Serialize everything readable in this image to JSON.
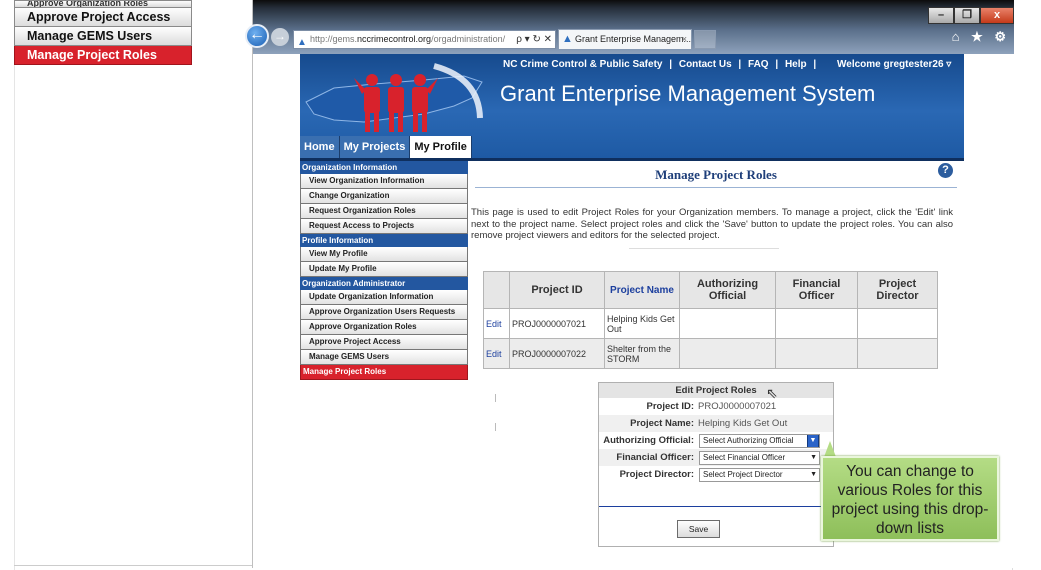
{
  "outer_menu": {
    "items": [
      {
        "label": "Approve Organization Roles"
      },
      {
        "label": "Approve Project Access"
      },
      {
        "label": "Manage GEMS Users"
      },
      {
        "label": "Manage Project Roles"
      }
    ]
  },
  "browser": {
    "url_gray_prefix": "http://gems.",
    "url_domain": "nccrimecontrol.org",
    "url_path": "/orgadministration/",
    "tab_title": "Grant Enterprise Managem...",
    "tab_close": "×",
    "window_buttons": {
      "minimize": "–",
      "restore": "❐",
      "close": "x"
    },
    "address_tools": "ρ ▾ ↻ ✕",
    "toolbar_icons": "⌂ ★ ⚙"
  },
  "site": {
    "top_links": {
      "org": "NC Crime Control & Public Safety",
      "sep": "|",
      "contact": "Contact Us",
      "faq": "FAQ",
      "help": "Help",
      "welcome": "Welcome gregtester26 ▿"
    },
    "title": "Grant Enterprise Management System",
    "nav_tabs": [
      {
        "label": "Home"
      },
      {
        "label": "My Projects"
      },
      {
        "label": "My Profile"
      }
    ],
    "sidebar": {
      "sections": [
        {
          "heading": "Organization Information",
          "items": [
            "View Organization Information",
            "Change Organization",
            "Request Organization Roles",
            "Request Access to Projects"
          ]
        },
        {
          "heading": "Profile Information",
          "items": [
            "View My Profile",
            "Update My Profile"
          ]
        },
        {
          "heading": "Organization Administrator",
          "items": [
            "Update Organization Information",
            "Approve Organization Users Requests",
            "Approve Organization Roles",
            "Approve Project Access",
            "Manage GEMS Users"
          ]
        }
      ],
      "active_item": "Manage Project Roles"
    },
    "page": {
      "title": "Manage Project Roles",
      "help": "?",
      "description": "This page is used to edit Project Roles for your Organization members. To manage a project, click the 'Edit' link next to the project name. Select project roles and click the 'Save' button to update the project roles. You can also remove project viewers and editors for the selected project."
    },
    "table": {
      "headers": [
        "",
        "Project ID",
        "Project Name",
        "Authorizing Official",
        "Financial Officer",
        "Project Director"
      ],
      "rows": [
        {
          "action": "Edit",
          "project_id": "PROJ0000007021",
          "project_name": "Helping Kids Get Out",
          "authorizing": "",
          "financial": "",
          "director": ""
        },
        {
          "action": "Edit",
          "project_id": "PROJ0000007022",
          "project_name": "Shelter from the STORM",
          "authorizing": "",
          "financial": "",
          "director": ""
        }
      ]
    },
    "edit_panel": {
      "title": "Edit Project Roles",
      "project_id_label": "Project ID:",
      "project_id_value": "PROJ0000007021",
      "project_name_label": "Project Name:",
      "project_name_value": "Helping Kids Get Out",
      "authorizing_label": "Authorizing Official:",
      "authorizing_value": "Select Authorizing Official",
      "financial_label": "Financial Officer:",
      "financial_value": "Select Financial Officer",
      "director_label": "Project Director:",
      "director_value": "Select Project Director",
      "save": "Save"
    }
  },
  "callout": {
    "text": "You can change to various Roles for this project using this drop-down lists"
  },
  "colors": {
    "active_red": "#d8222c",
    "header_blue": "#2a68b4",
    "callout_green": "#a5d072"
  }
}
